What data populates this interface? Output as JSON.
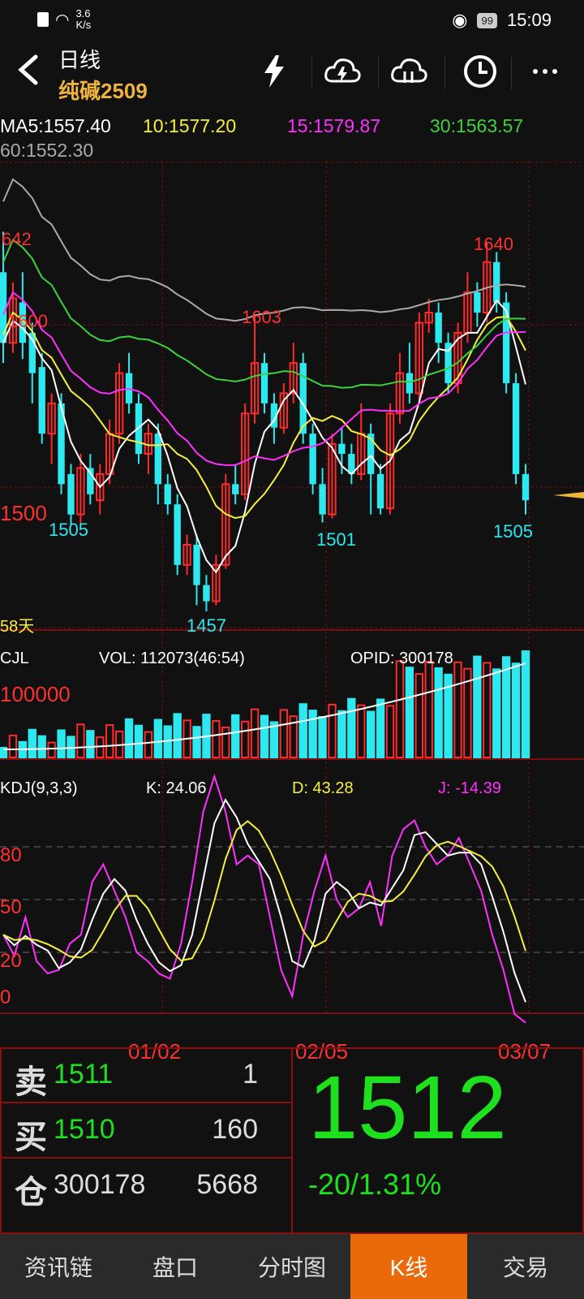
{
  "status": {
    "net_speed_value": "3.6",
    "net_speed_unit": "K/s",
    "battery": "99",
    "time": "15:09"
  },
  "header": {
    "period": "日线",
    "symbol": "纯碱2509"
  },
  "ma": {
    "ma5": "MA5:1557.40",
    "ma10": "10:1577.20",
    "ma15": "15:1579.87",
    "ma30": "30:1563.57",
    "ma60": "60:1552.30"
  },
  "main_chart": {
    "price_labels": {
      "high_left": "642",
      "mid_left": "1600",
      "low_left": "1500",
      "peak_mid": "1603",
      "peak_right": "1640",
      "low_1": "1505",
      "low_2": "1457",
      "low_3": "1501",
      "low_4": "1505"
    },
    "days_label": "58天"
  },
  "volume": {
    "title": "CJL",
    "vol": "VOL: 112073(46:54)",
    "opid": "OPID: 300178",
    "axis_label": "100000"
  },
  "kdj": {
    "title": "KDJ(9,3,3)",
    "k": "K: 24.06",
    "d": "D: 43.28",
    "j": "J: -14.39",
    "levels": [
      "80",
      "50",
      "20",
      "0"
    ]
  },
  "dates": [
    "01/02",
    "02/05",
    "03/07"
  ],
  "colors": {
    "up": "#ff2a2a",
    "down": "#2ee8f0",
    "ma5": "#ffffff",
    "ma10": "#f5f03c",
    "ma15": "#ff30ff",
    "ma30": "#3cd23c",
    "ma60": "#aaaaaa",
    "accent": "#ea6a0b",
    "price_green": "#1ee01e"
  },
  "orders": {
    "sell_label": "卖",
    "sell_price": "1511",
    "sell_qty": "1",
    "buy_label": "买",
    "buy_price": "1510",
    "buy_qty": "160",
    "oi_label": "仓",
    "oi_value": "300178",
    "oi_change": "5668",
    "last_price": "1512",
    "change": "-20/1.31%"
  },
  "nav": {
    "tabs": [
      "资讯链",
      "盘口",
      "分时图",
      "K线",
      "交易"
    ],
    "active": "K线"
  },
  "icons": [
    "back-icon",
    "flash-icon",
    "cloud-download-icon",
    "cloud-upload-icon",
    "clock-icon",
    "more-icon"
  ]
}
